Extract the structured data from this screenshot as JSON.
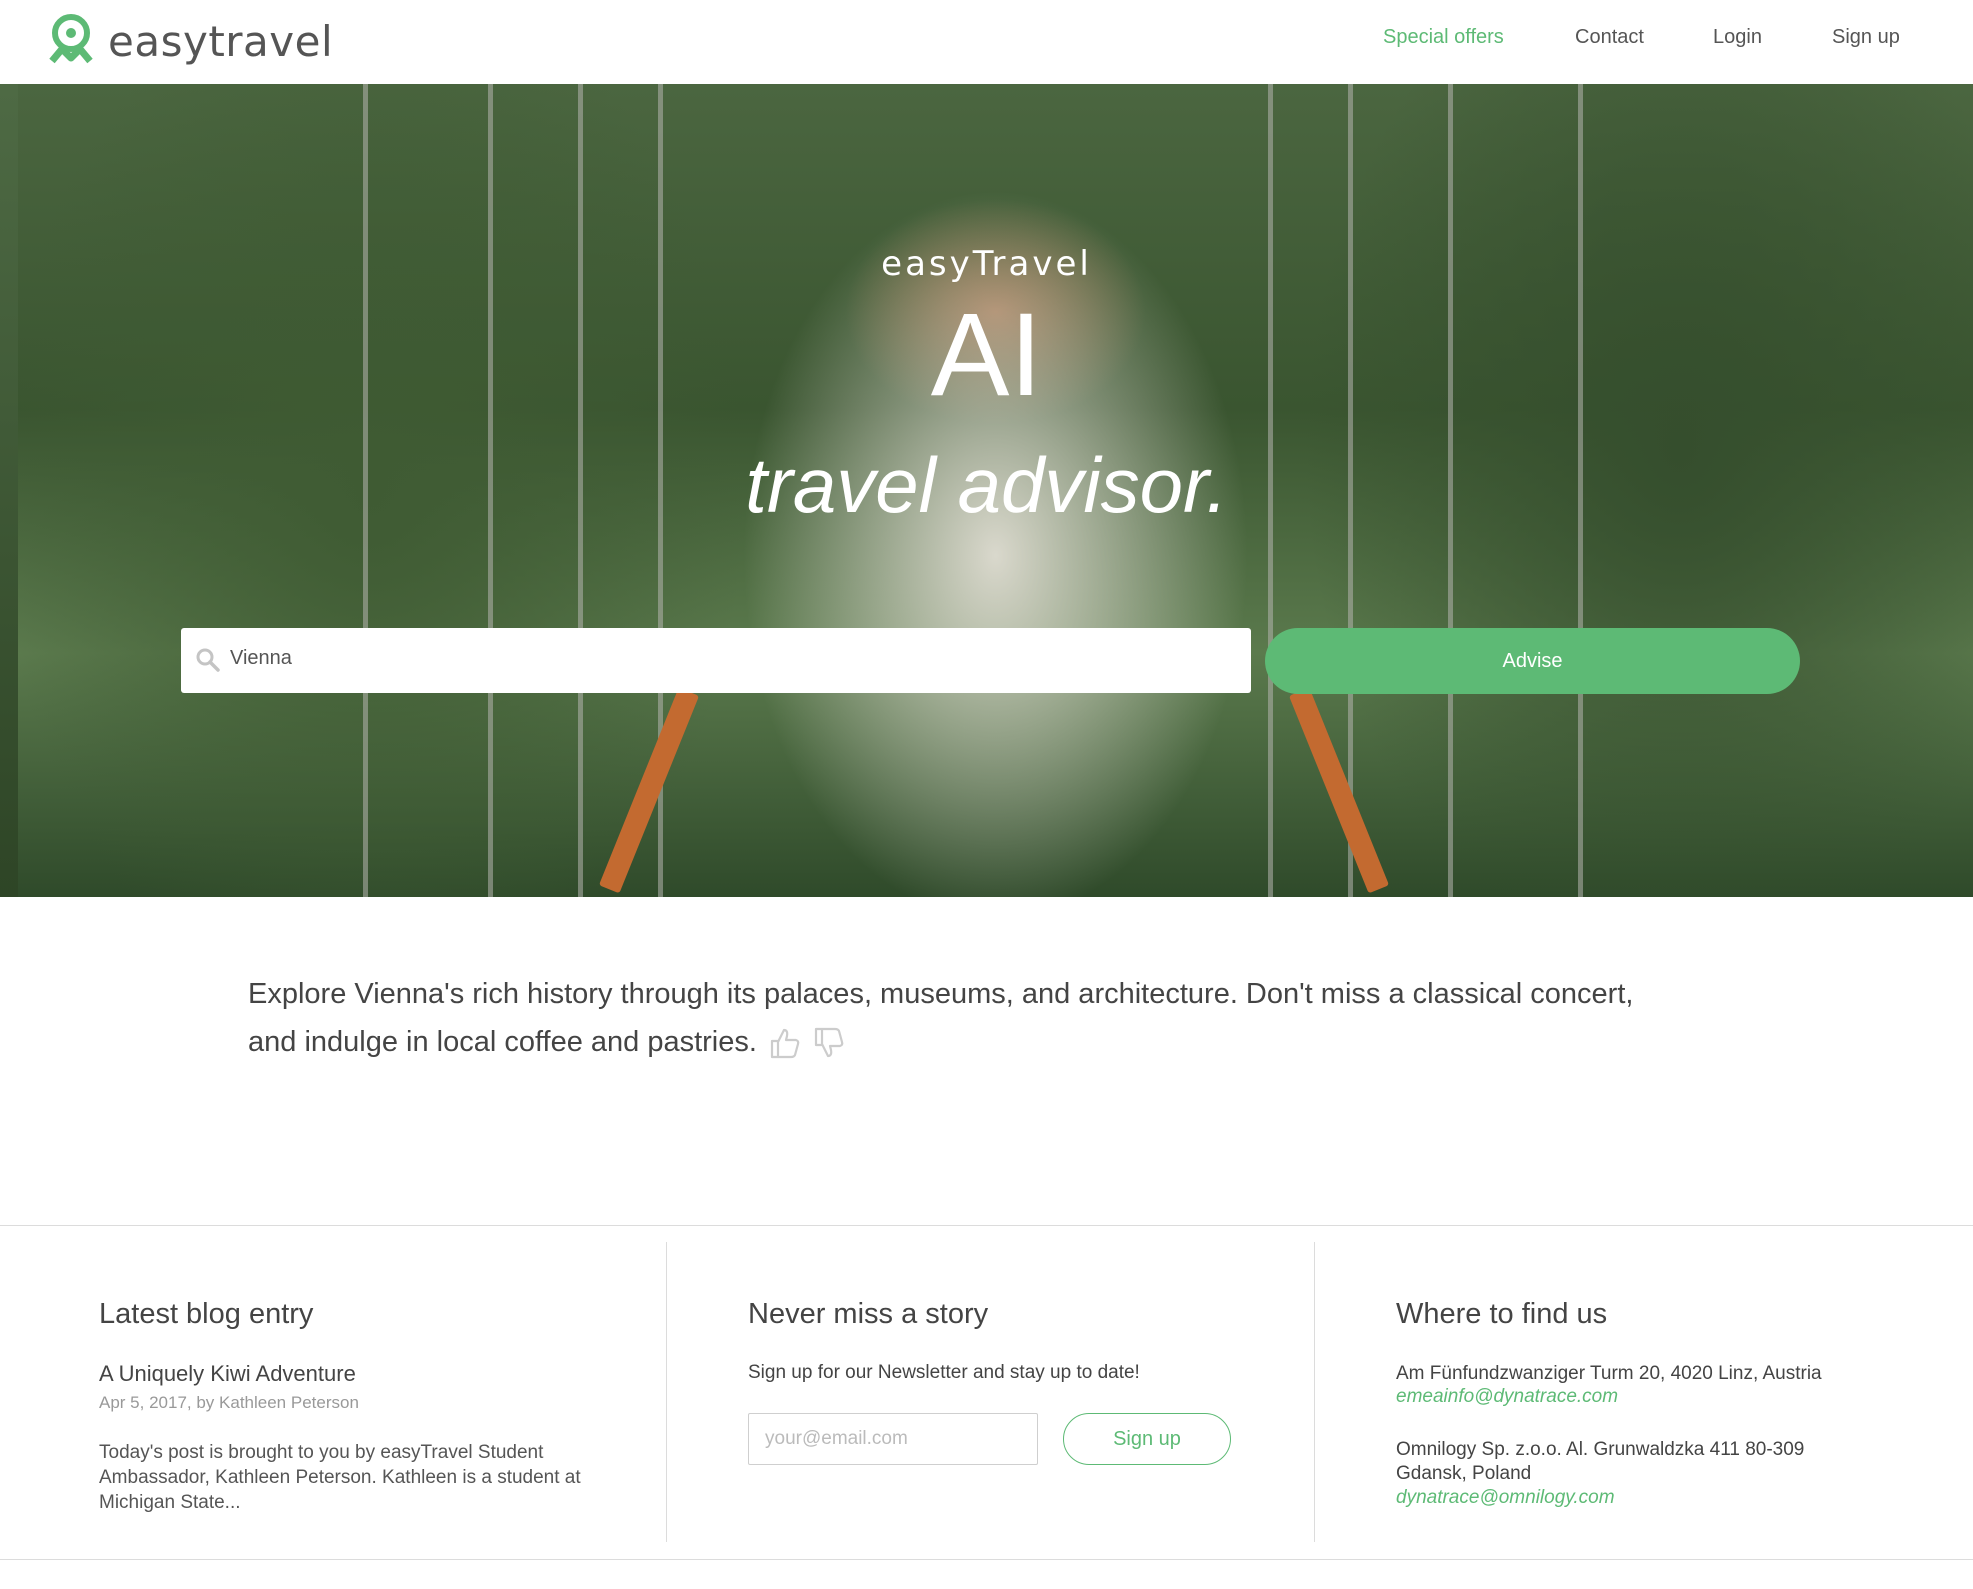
{
  "colors": {
    "accent": "#5dba75"
  },
  "header": {
    "logo_text": "easytravel",
    "nav": [
      "Special offers",
      "Contact",
      "Login",
      "Sign up"
    ]
  },
  "hero": {
    "brand": "easyTravel",
    "headline": "AI",
    "subheadline": "travel advisor.",
    "search": {
      "value": "Vienna",
      "icon": "search-icon"
    },
    "advise_label": "Advise"
  },
  "advice": {
    "text": "Explore Vienna's rich history through its palaces, museums, and architecture. Don't miss a classical concert, and indulge in local coffee and pastries.",
    "icons": [
      "thumbs-up-icon",
      "thumbs-down-icon"
    ]
  },
  "footer": {
    "blog": {
      "heading": "Latest blog entry",
      "title": "A Uniquely Kiwi Adventure",
      "meta": "Apr 5, 2017, by Kathleen Peterson",
      "excerpt": "Today's post is brought to you by easyTravel Student Ambassador, Kathleen Peterson. Kathleen is a student at Michigan State..."
    },
    "newsletter": {
      "heading": "Never miss a story",
      "text": "Sign up for our Newsletter and stay up to date!",
      "placeholder": "your@email.com",
      "button": "Sign up"
    },
    "contact": {
      "heading": "Where to find us",
      "address1": "Am Fünfundzwanziger Turm 20, 4020 Linz, Austria",
      "email1": "emeainfo@dynatrace.com",
      "address2_line1": "Omnilogy Sp. z.o.o. Al. Grunwaldzka 411 80-309",
      "address2_line2": "Gdansk, Poland",
      "email2": "dynatrace@omnilogy.com"
    }
  }
}
